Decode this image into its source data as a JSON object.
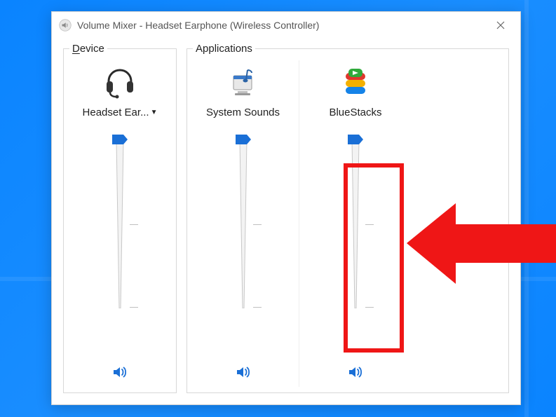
{
  "window": {
    "title": "Volume Mixer - Headset Earphone (Wireless Controller)"
  },
  "groups": {
    "device_legend": "Device",
    "apps_legend": "Applications"
  },
  "channels": {
    "device": {
      "label": "Headset Ear...",
      "volume": 100,
      "muted": false,
      "icon": "headset"
    },
    "system": {
      "label": "System Sounds",
      "volume": 100,
      "muted": false,
      "icon": "system-sounds"
    },
    "bluestacks": {
      "label": "BlueStacks",
      "volume": 100,
      "muted": false,
      "icon": "bluestacks"
    }
  },
  "colors": {
    "accent": "#1a6fd6",
    "annotation": "#ef1616"
  }
}
